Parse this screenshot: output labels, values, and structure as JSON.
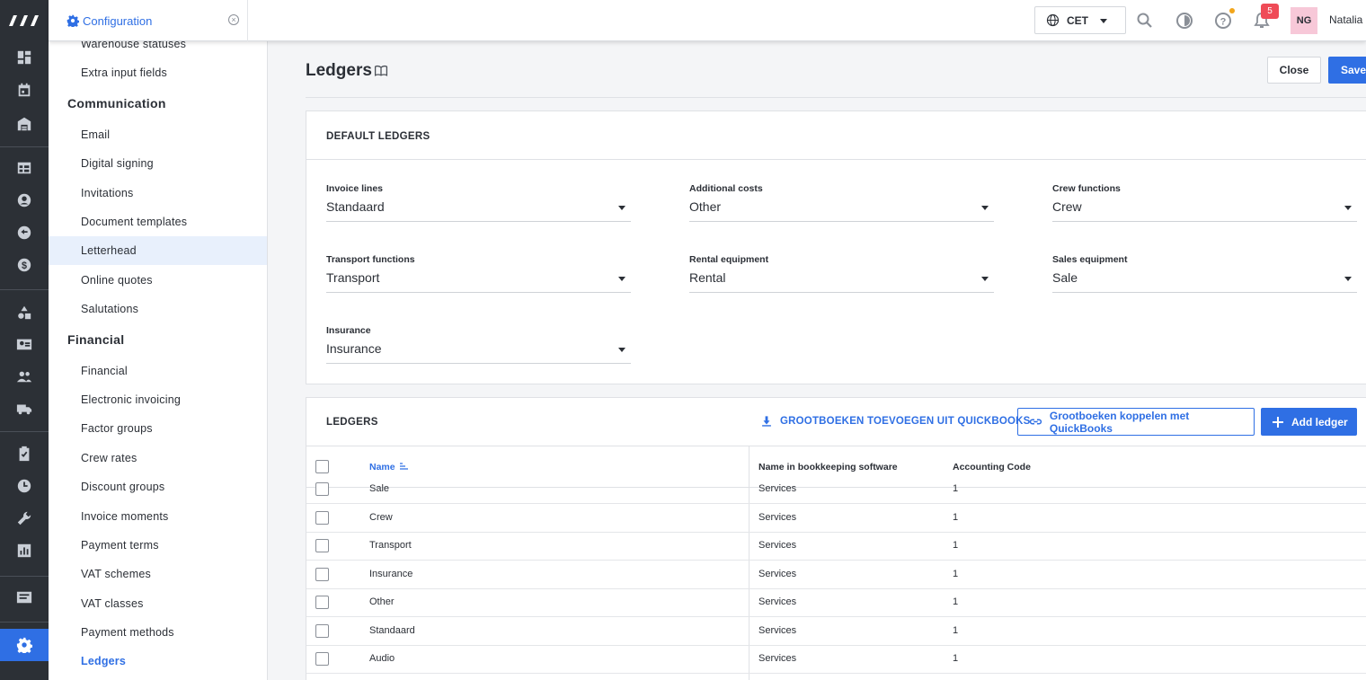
{
  "topbar": {
    "tab_label": "Configuration",
    "timezone": "CET",
    "notifications_count": "5",
    "avatar_initials": "NG",
    "user_name": "Natalia"
  },
  "nav": {
    "items_top": [
      "Warehouse statuses",
      "Extra input fields"
    ],
    "communication_header": "Communication",
    "communication_items": [
      "Email",
      "Digital signing",
      "Invitations",
      "Document templates",
      "Letterhead",
      "Online quotes",
      "Salutations"
    ],
    "financial_header": "Financial",
    "financial_items": [
      "Financial",
      "Electronic invoicing",
      "Factor groups",
      "Crew rates",
      "Discount groups",
      "Invoice moments",
      "Payment terms",
      "VAT schemes",
      "VAT classes",
      "Payment methods",
      "Ledgers"
    ]
  },
  "page": {
    "title": "Ledgers",
    "close_label": "Close",
    "save_label": "Save"
  },
  "default_ledgers": {
    "header": "DEFAULT LEDGERS",
    "fields": [
      {
        "label": "Invoice lines",
        "value": "Standaard"
      },
      {
        "label": "Additional costs",
        "value": "Other"
      },
      {
        "label": "Crew functions",
        "value": "Crew"
      },
      {
        "label": "Transport functions",
        "value": "Transport"
      },
      {
        "label": "Rental equipment",
        "value": "Rental"
      },
      {
        "label": "Sales equipment",
        "value": "Sale"
      },
      {
        "label": "Insurance",
        "value": "Insurance"
      }
    ]
  },
  "ledgers": {
    "header": "LEDGERS",
    "import_link": "GROOTBOEKEN TOEVOEGEN UIT QUICKBOOKS",
    "connect_button": "Grootboeken koppelen met QuickBooks",
    "add_button": "Add ledger",
    "columns": [
      "Name",
      "Name in bookkeeping software",
      "Accounting Code"
    ],
    "rows": [
      {
        "name": "Sale",
        "bookkeeping": "Services",
        "code": "1"
      },
      {
        "name": "Crew",
        "bookkeeping": "Services",
        "code": "1"
      },
      {
        "name": "Transport",
        "bookkeeping": "Services",
        "code": "1"
      },
      {
        "name": "Insurance",
        "bookkeeping": "Services",
        "code": "1"
      },
      {
        "name": "Other",
        "bookkeeping": "Services",
        "code": "1"
      },
      {
        "name": "Standaard",
        "bookkeeping": "Services",
        "code": "1"
      },
      {
        "name": "Audio",
        "bookkeeping": "Services",
        "code": "1"
      }
    ]
  },
  "colors": {
    "accent": "#2f6fe4",
    "rail": "#2c3036",
    "badge": "#ef4b57"
  }
}
